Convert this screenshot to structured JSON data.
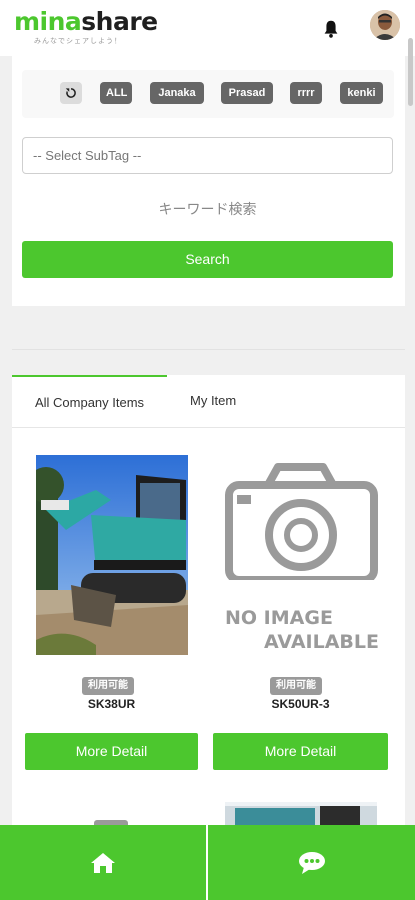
{
  "header": {
    "logo_primary": "mina",
    "logo_secondary": "share",
    "logo_tagline": "みんなでシェアしよう！"
  },
  "tags": {
    "items": [
      "ALL",
      "Janaka",
      "Prasad",
      "rrrr",
      "kenki"
    ]
  },
  "search": {
    "subtag_placeholder": "-- Select SubTag --",
    "keyword_placeholder": "キーワード検索",
    "button_label": "Search"
  },
  "tabs": {
    "all_company": "All Company Items",
    "my_item": "My Item"
  },
  "items": [
    {
      "status": "利用可能",
      "name": "SK38UR",
      "detail_label": "More Detail"
    },
    {
      "status": "利用可能",
      "name": "SK50UR-3",
      "detail_label": "More Detail",
      "no_image_line1": "NO IMAGE",
      "no_image_line2": "AVAILABLE"
    }
  ],
  "colors": {
    "accent": "#4cc72e",
    "tag_bg": "#666666",
    "badge_bg": "#9a9a9a"
  },
  "icons": [
    "bell-icon",
    "avatar",
    "reset-icon",
    "camera-icon",
    "home-icon",
    "chat-icon"
  ]
}
